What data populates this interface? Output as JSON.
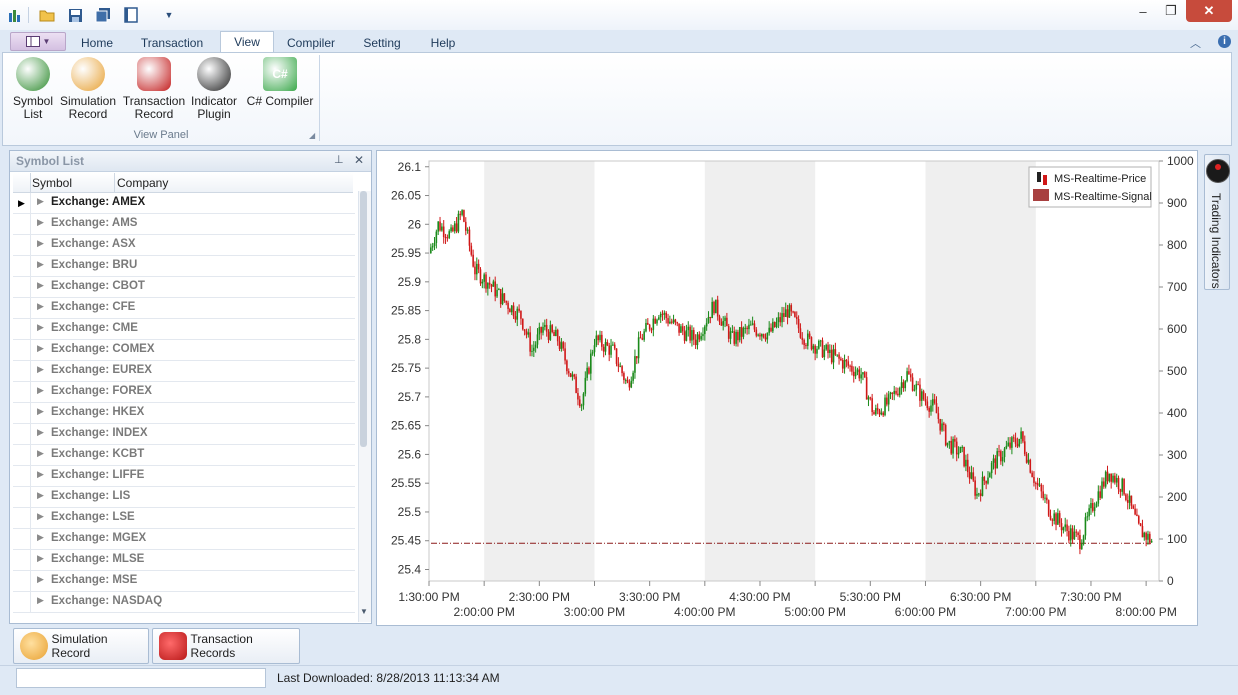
{
  "quick_access": {
    "icons": [
      "app-icon",
      "open-folder-icon",
      "save-icon",
      "save-all-icon",
      "document-icon",
      "customize-dropdown-icon"
    ]
  },
  "window_controls": {
    "minimize": "–",
    "restore": "❐",
    "close": "✕"
  },
  "ribbon": {
    "tabs": [
      "Home",
      "Transaction",
      "View",
      "Compiler",
      "Setting",
      "Help"
    ],
    "active_tab": "View",
    "buttons": [
      {
        "label": "Symbol\nList",
        "icon": "bank-icon",
        "color": "#2e8b2e"
      },
      {
        "label": "Simulation\nRecord",
        "icon": "simulation-icon",
        "color": "#e8a030"
      },
      {
        "label": "Transaction\nRecord",
        "icon": "hold-icon",
        "color": "#c42020"
      },
      {
        "label": "Indicator\nPlugin",
        "icon": "gauge-icon",
        "color": "#222222"
      },
      {
        "label": "C# Compiler",
        "icon": "csharp-icon",
        "color": "#3aa84a"
      }
    ],
    "group_label": "View Panel"
  },
  "symbol_list": {
    "title": "Symbol List",
    "pin": "⊥",
    "close": "✕",
    "columns": [
      "Symbol",
      "Company"
    ],
    "rows": [
      "Exchange: AMEX",
      "Exchange: AMS",
      "Exchange: ASX",
      "Exchange: BRU",
      "Exchange: CBOT",
      "Exchange: CFE",
      "Exchange: CME",
      "Exchange: COMEX",
      "Exchange: EUREX",
      "Exchange: FOREX",
      "Exchange: HKEX",
      "Exchange: INDEX",
      "Exchange: KCBT",
      "Exchange: LIFFE",
      "Exchange: LIS",
      "Exchange: LSE",
      "Exchange: MGEX",
      "Exchange: MLSE",
      "Exchange: MSE",
      "Exchange: NASDAQ"
    ],
    "selected_index": 0
  },
  "side_dock": {
    "label": "Trading Indicators"
  },
  "bottom_tabs": [
    {
      "label": "Simulation Record",
      "icon": "simulation-icon",
      "color": "#e8a030"
    },
    {
      "label": "Transaction Records",
      "icon": "hold-icon",
      "color": "#c42020"
    }
  ],
  "status": {
    "last_downloaded": "Last Downloaded: 8/28/2013 11:13:34 AM"
  },
  "chart_data": {
    "type": "candlestick",
    "legend": [
      "MS-Realtime-Price",
      "MS-Realtime-Signal"
    ],
    "legend_placement": "top-right",
    "y_left_ticks": [
      "26.1",
      "26.05",
      "26",
      "25.95",
      "25.9",
      "25.85",
      "25.8",
      "25.75",
      "25.7",
      "25.65",
      "25.6",
      "25.55",
      "25.5",
      "25.45",
      "25.4"
    ],
    "y_left_range": [
      25.38,
      26.11
    ],
    "y_right_ticks": [
      "1000",
      "900",
      "800",
      "700",
      "600",
      "500",
      "400",
      "300",
      "200",
      "100",
      "0"
    ],
    "y_right_range": [
      0,
      1000
    ],
    "x_ticks_top": [
      "1:30:00 PM",
      "2:30:00 PM",
      "3:30:00 PM",
      "4:30:00 PM",
      "5:30:00 PM",
      "6:30:00 PM",
      "7:30:00 PM"
    ],
    "x_ticks_bottom": [
      "2:00:00 PM",
      "3:00:00 PM",
      "4:00:00 PM",
      "5:00:00 PM",
      "6:00:00 PM",
      "7:00:00 PM",
      "8:00:00 PM"
    ],
    "x_range_minutes": [
      810,
      1207
    ],
    "price_path": [
      [
        810,
        25.95
      ],
      [
        815,
        26.0
      ],
      [
        822,
        25.98
      ],
      [
        828,
        26.02
      ],
      [
        835,
        25.92
      ],
      [
        842,
        25.9
      ],
      [
        850,
        25.87
      ],
      [
        860,
        25.84
      ],
      [
        866,
        25.78
      ],
      [
        872,
        25.82
      ],
      [
        880,
        25.8
      ],
      [
        887,
        25.74
      ],
      [
        893,
        25.69
      ],
      [
        900,
        25.8
      ],
      [
        910,
        25.78
      ],
      [
        918,
        25.72
      ],
      [
        925,
        25.8
      ],
      [
        935,
        25.85
      ],
      [
        945,
        25.82
      ],
      [
        955,
        25.8
      ],
      [
        965,
        25.86
      ],
      [
        975,
        25.8
      ],
      [
        985,
        25.82
      ],
      [
        995,
        25.81
      ],
      [
        1005,
        25.85
      ],
      [
        1015,
        25.8
      ],
      [
        1025,
        25.78
      ],
      [
        1035,
        25.76
      ],
      [
        1045,
        25.74
      ],
      [
        1052,
        25.67
      ],
      [
        1060,
        25.69
      ],
      [
        1070,
        25.74
      ],
      [
        1078,
        25.7
      ],
      [
        1085,
        25.68
      ],
      [
        1092,
        25.62
      ],
      [
        1100,
        25.6
      ],
      [
        1108,
        25.53
      ],
      [
        1116,
        25.58
      ],
      [
        1124,
        25.61
      ],
      [
        1132,
        25.63
      ],
      [
        1140,
        25.55
      ],
      [
        1148,
        25.5
      ],
      [
        1156,
        25.47
      ],
      [
        1164,
        25.45
      ],
      [
        1172,
        25.52
      ],
      [
        1180,
        25.57
      ],
      [
        1188,
        25.54
      ],
      [
        1196,
        25.47
      ],
      [
        1203,
        25.45
      ]
    ],
    "signal_value": 90
  }
}
